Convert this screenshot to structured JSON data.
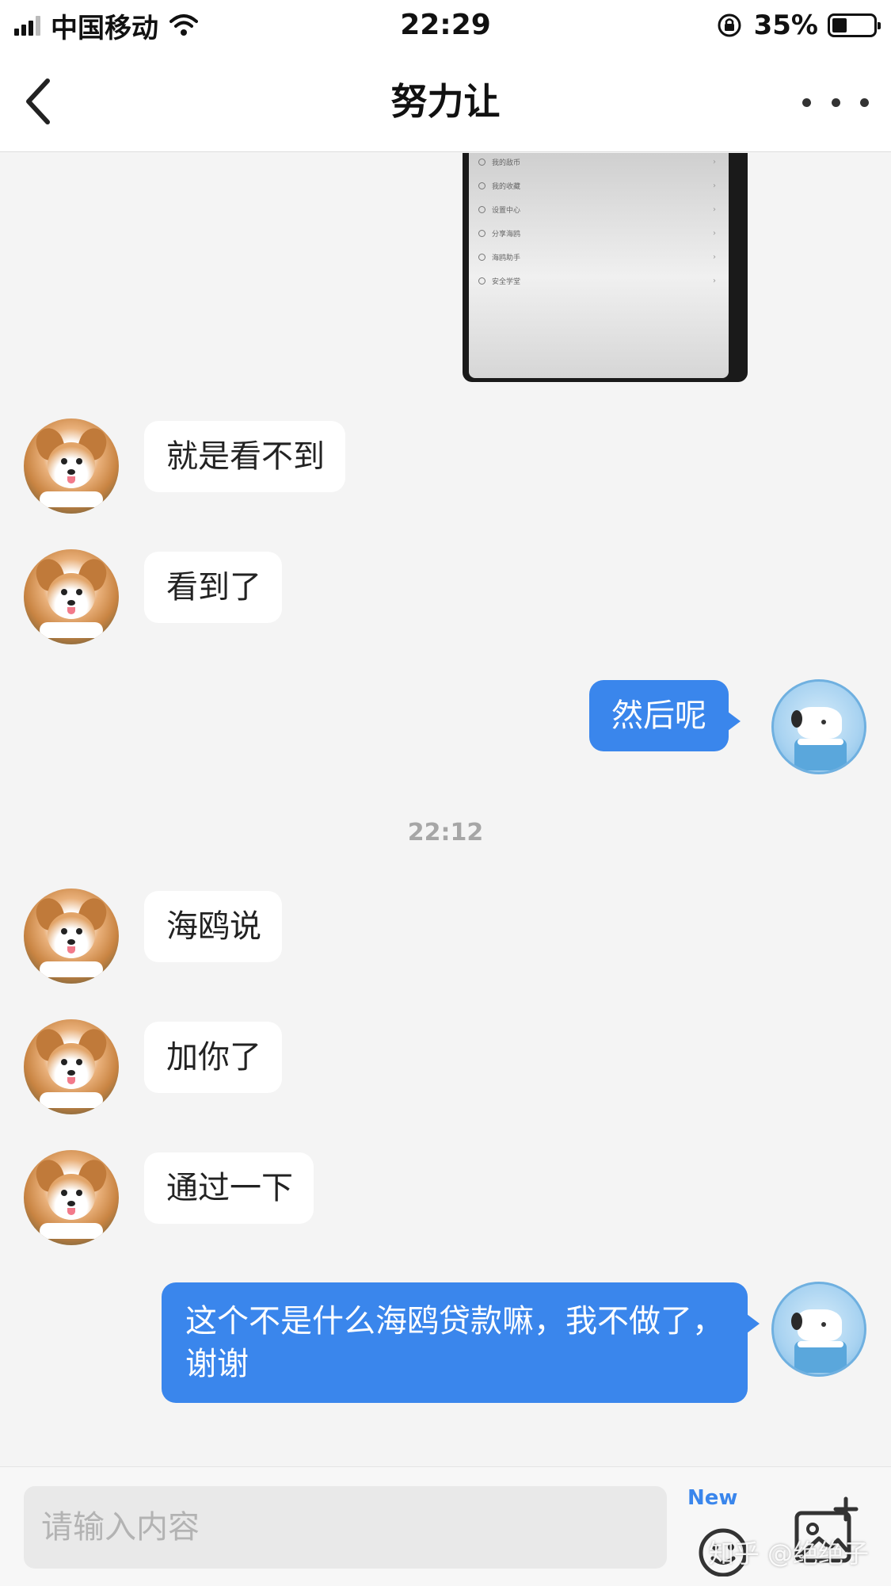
{
  "status_bar": {
    "carrier": "中国移动",
    "time": "22:29",
    "battery_percent": "35%",
    "battery_level": 0.35,
    "icons": [
      "signal-icon",
      "wifi-icon",
      "orientation-lock-icon",
      "battery-icon"
    ]
  },
  "nav": {
    "title": "努力让",
    "back_icon": "chevron-left-icon",
    "more_icon": "ellipsis-icon"
  },
  "shared_image": {
    "menu_items": [
      "我的敌币",
      "我的收藏",
      "设置中心",
      "分享海鸥",
      "海鸥助手",
      "安全学堂"
    ]
  },
  "messages": [
    {
      "side": "in",
      "text": "就是看不到"
    },
    {
      "side": "in",
      "text": "看到了"
    },
    {
      "side": "out",
      "text": "然后呢"
    },
    {
      "type": "time",
      "text": "22:12"
    },
    {
      "side": "in",
      "text": "海鸥说"
    },
    {
      "side": "in",
      "text": "加你了"
    },
    {
      "side": "in",
      "text": "通过一下"
    },
    {
      "side": "out",
      "text": "这个不是什么海鸥贷款嘛，我不做了，谢谢"
    }
  ],
  "input_bar": {
    "placeholder": "请输入内容",
    "new_badge": "New",
    "emoji_icon": "emoji-icon",
    "image_icon": "add-image-icon"
  },
  "watermark": "知乎 @绝绝子",
  "colors": {
    "outgoing_bubble": "#3a86ec",
    "incoming_bubble": "#ffffff",
    "background": "#f4f4f4"
  }
}
